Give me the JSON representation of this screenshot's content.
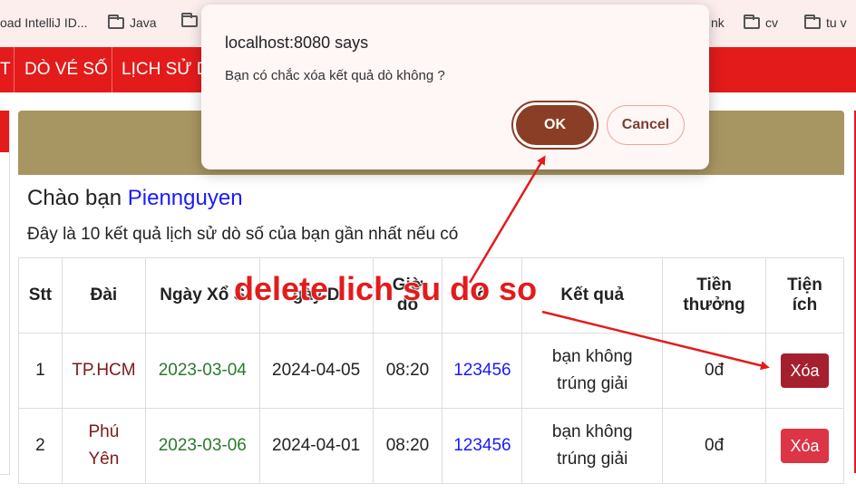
{
  "bookmarks": [
    {
      "label": "oad IntelliJ ID..."
    },
    {
      "label": "Java"
    },
    {
      "label": ""
    },
    {
      "label": "nk"
    },
    {
      "label": "cv"
    },
    {
      "label": "tu v"
    }
  ],
  "nav": {
    "items": [
      "T",
      "DÒ VÉ SỐ",
      "LỊCH SỬ D"
    ]
  },
  "greeting": {
    "prefix": "Chào bạn ",
    "username": "Piennguyen"
  },
  "description": "Đây là 10 kết quả lịch sử dò số của bạn gần nhất nếu có",
  "table": {
    "headers": {
      "stt": "Stt",
      "dai": "Đài",
      "ngay_xo": "Ngày Xổ S",
      "ngay_do": "gày D",
      "gio_do_1": "Giờ",
      "gio_do_2": "dò",
      "so": "ố",
      "ket_qua": "Kết quả",
      "tien_thuong_1": "Tiền",
      "tien_thuong_2": "thưởng",
      "tien_ich_1": "Tiện",
      "tien_ich_2": "ích"
    },
    "rows": [
      {
        "stt": "1",
        "dai_1": "TP.HCM",
        "dai_2": "",
        "ngay_xo": "2023-03-04",
        "ngay_do": "2024-04-05",
        "gio_do": "08:20",
        "so": "123456",
        "ket_qua_1": "bạn không",
        "ket_qua_2": "trúng giải",
        "tien_thuong": "0đ",
        "action": "Xóa"
      },
      {
        "stt": "2",
        "dai_1": "Phú",
        "dai_2": "Yên",
        "ngay_xo": "2023-03-06",
        "ngay_do": "2024-04-01",
        "gio_do": "08:20",
        "so": "123456",
        "ket_qua_1": "bạn không",
        "ket_qua_2": "trúng giải",
        "tien_thuong": "0đ",
        "action": "Xóa"
      }
    ]
  },
  "dialog": {
    "title": "localhost:8080 says",
    "message": "Bạn có chắc xóa kết quả dò không ?",
    "ok_label": "OK",
    "cancel_label": "Cancel"
  },
  "annotation": {
    "text": "delete lich su do so",
    "color": "#e31b1b"
  },
  "colors": {
    "nav_red": "#e31b1b",
    "header_gold": "#a89662",
    "ok_brown": "#8a3e25",
    "delete_red": "#dc3545"
  }
}
